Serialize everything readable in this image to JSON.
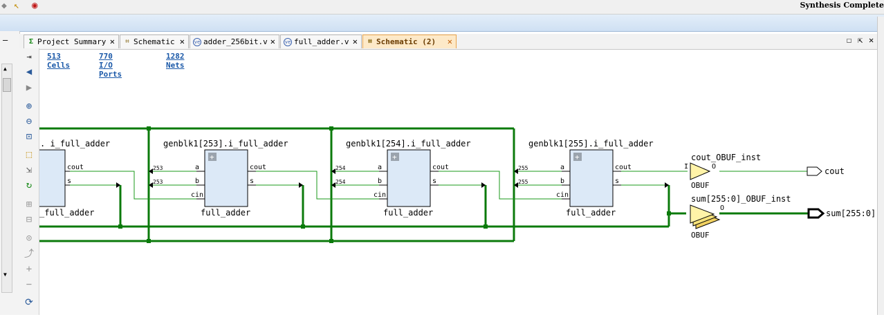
{
  "status": {
    "text": "Synthesis Complete"
  },
  "tabs": [
    {
      "label": "Project Summary",
      "icon": "sigma-icon",
      "active": false
    },
    {
      "label": "Schematic",
      "icon": "schematic-icon",
      "active": false
    },
    {
      "label": "adder_256bit.v",
      "icon": "verilog-file-icon",
      "active": false
    },
    {
      "label": "full_adder.v",
      "icon": "verilog-file-icon",
      "active": false
    },
    {
      "label": "Schematic (2)",
      "icon": "schematic-icon",
      "active": true
    }
  ],
  "stats": {
    "cells": "513 Cells",
    "io_ports": "770 I/O Ports",
    "nets": "1282 Nets"
  },
  "schematic": {
    "partial_instance": ". i_full_adder",
    "partial_type": "_full_adder",
    "instances": [
      {
        "name": "genblk1[253].i_full_adder",
        "type": "full_adder",
        "bit": "253"
      },
      {
        "name": "genblk1[254].i_full_adder",
        "type": "full_adder",
        "bit": "254"
      },
      {
        "name": "genblk1[255].i_full_adder",
        "type": "full_adder",
        "bit": "255"
      }
    ],
    "pins": {
      "a": "a",
      "b": "b",
      "cin": "cin",
      "cout": "cout",
      "s": "s",
      "plus": "+"
    },
    "cout_buf": {
      "name": "cout_OBUF_inst",
      "type": "OBUF",
      "in": "I",
      "out": "O"
    },
    "sum_buf": {
      "name": "sum[255:0]_OBUF_inst",
      "type": "OBUF",
      "out": "O"
    },
    "ports": {
      "cout": "cout",
      "sum": "sum[255:0]"
    }
  },
  "colors": {
    "wire": "#0b7a0b",
    "cell_fill": "#dce9f7",
    "buffer_fill": "#fff3a8",
    "active_tab": "#fde9c8"
  }
}
